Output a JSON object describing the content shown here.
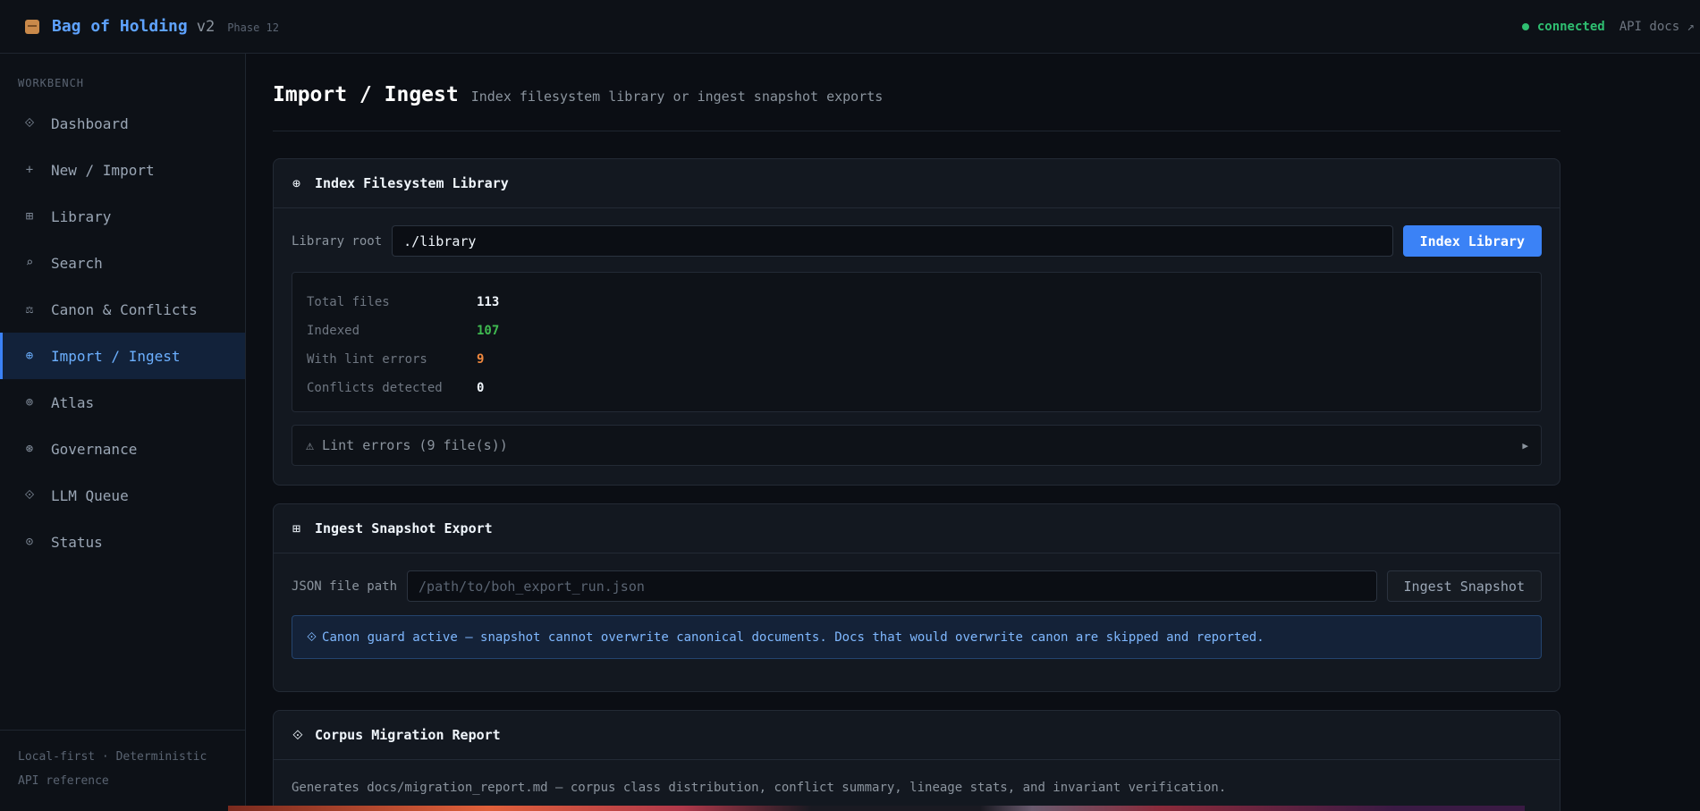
{
  "header": {
    "brand": "Bag of Holding",
    "version": "v2",
    "phase": "Phase 12",
    "status": "connected",
    "api_docs": "API docs ↗"
  },
  "sidebar": {
    "section": "WORKBENCH",
    "items": [
      {
        "label": "Dashboard",
        "icon": "diamond-icon",
        "glyph": "⟐"
      },
      {
        "label": "New / Import",
        "icon": "plus-icon",
        "glyph": "+"
      },
      {
        "label": "Library",
        "icon": "grid-icon",
        "glyph": "⊞"
      },
      {
        "label": "Search",
        "icon": "search-icon",
        "glyph": "⌕"
      },
      {
        "label": "Canon & Conflicts",
        "icon": "scales-icon",
        "glyph": "⚖"
      },
      {
        "label": "Import / Ingest",
        "icon": "globe-icon",
        "glyph": "⊕"
      },
      {
        "label": "Atlas",
        "icon": "target-icon",
        "glyph": "⊚"
      },
      {
        "label": "Governance",
        "icon": "shield-icon",
        "glyph": "⊛"
      },
      {
        "label": "LLM Queue",
        "icon": "diamond-icon",
        "glyph": "⟐"
      },
      {
        "label": "Status",
        "icon": "status-icon",
        "glyph": "⊙"
      }
    ],
    "active_index": 5,
    "footer_line1": "Local-first · Deterministic",
    "footer_line2": "API reference"
  },
  "page": {
    "title": "Import / Ingest",
    "subtitle": "Index filesystem library or ingest snapshot exports"
  },
  "index_card": {
    "icon": "globe-icon",
    "glyph": "⊕",
    "title": "Index Filesystem Library",
    "field_label": "Library root",
    "field_value": "./library",
    "button": "Index Library",
    "stats": [
      {
        "label": "Total files",
        "value": "113"
      },
      {
        "label": "Indexed",
        "value": "107"
      },
      {
        "label": "With lint errors",
        "value": "9"
      },
      {
        "label": "Conflicts detected",
        "value": "0"
      }
    ],
    "lint_summary": "⚠ Lint errors (9 file(s))",
    "lint_arrow": "▶"
  },
  "snapshot_card": {
    "icon": "table-icon",
    "glyph": "⊞",
    "title": "Ingest Snapshot Export",
    "field_label": "JSON file path",
    "field_placeholder": "/path/to/boh_export_run.json",
    "button": "Ingest Snapshot",
    "notice_glyph": "⟐",
    "notice": "Canon guard active — snapshot cannot overwrite canonical documents. Docs that would overwrite canon are skipped and reported."
  },
  "migration_card": {
    "icon": "diamond-icon",
    "glyph": "⟐",
    "title": "Corpus Migration Report",
    "description": "Generates docs/migration_report.md — corpus class distribution, conflict summary, lineage stats, and invariant verification."
  },
  "colors": {
    "accent": "#3b82f6",
    "connected": "#2fbf71",
    "indexed": "#3fb950",
    "lint": "#f0883e"
  }
}
